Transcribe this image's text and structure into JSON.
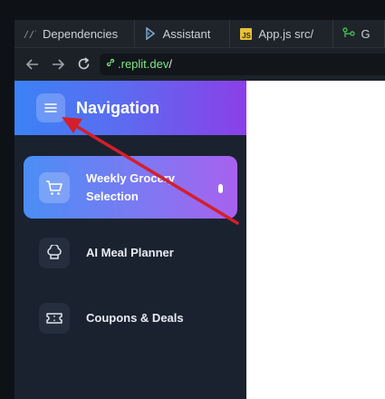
{
  "browser": {
    "tabs": [
      {
        "label": "Dependencies",
        "icon": "dependencies-icon"
      },
      {
        "label": "Assistant",
        "icon": "assistant-icon"
      },
      {
        "label": "App.js src/",
        "icon": "javascript-file-icon"
      },
      {
        "label": "G",
        "icon": "git-icon"
      }
    ],
    "js_badge": "JS",
    "url_domain": ".replit.dev",
    "url_path": "/"
  },
  "app": {
    "sidebar_title": "Navigation",
    "nav_items": [
      {
        "label": "Weekly Grocery Selection",
        "icon": "cart-icon",
        "active": true
      },
      {
        "label": "AI Meal Planner",
        "icon": "chef-hat-icon",
        "active": false
      },
      {
        "label": "Coupons & Deals",
        "icon": "ticket-icon",
        "active": false
      }
    ]
  },
  "colors": {
    "header_gradient_start": "#3b82f6",
    "header_gradient_end": "#8b3fe8",
    "annotation_arrow": "#d41f2b",
    "url_green": "#7ee787"
  }
}
